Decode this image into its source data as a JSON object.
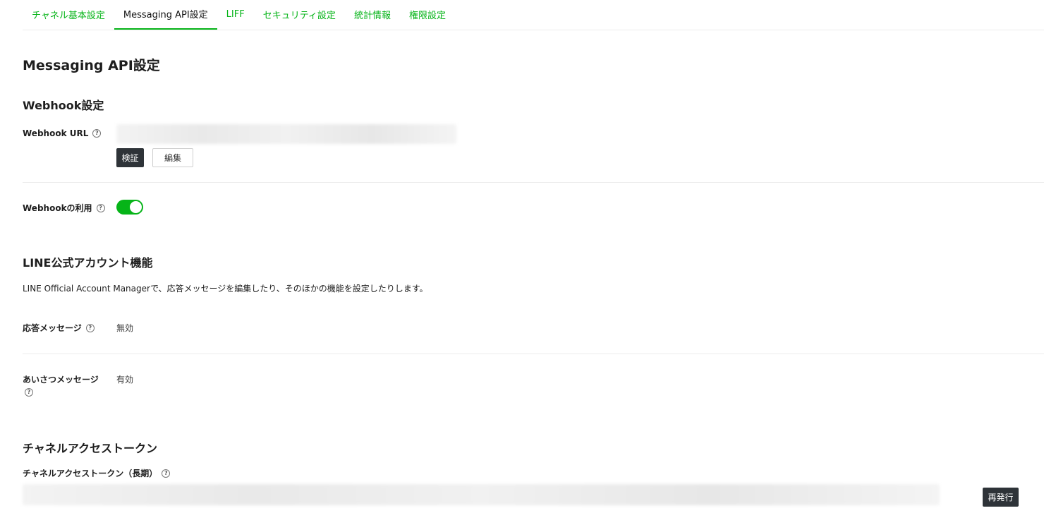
{
  "tabs": [
    {
      "label": "チャネル基本設定",
      "active": false
    },
    {
      "label": "Messaging API設定",
      "active": true
    },
    {
      "label": "LIFF",
      "active": false
    },
    {
      "label": "セキュリティ設定",
      "active": false
    },
    {
      "label": "統計情報",
      "active": false
    },
    {
      "label": "権限設定",
      "active": false
    }
  ],
  "page_title": "Messaging API設定",
  "webhook": {
    "section_title": "Webhook設定",
    "url_label": "Webhook URL",
    "verify_button": "検証",
    "edit_button": "編集",
    "use_label": "Webhookの利用",
    "use_enabled": true
  },
  "oa": {
    "section_title": "LINE公式アカウント機能",
    "description": "LINE Official Account Managerで、応答メッセージを編集したり、そのほかの機能を設定したりします。",
    "auto_reply_label": "応答メッセージ",
    "auto_reply_value": "無効",
    "greeting_label": "あいさつメッセージ",
    "greeting_value": "有効"
  },
  "token": {
    "section_title": "チャネルアクセストークン",
    "long_label": "チャネルアクセストークン（長期）",
    "reissue_button": "再発行"
  },
  "colors": {
    "accent": "#06b418",
    "dark_button": "#2e3338"
  },
  "icons": {
    "help": "help-circle-icon"
  }
}
